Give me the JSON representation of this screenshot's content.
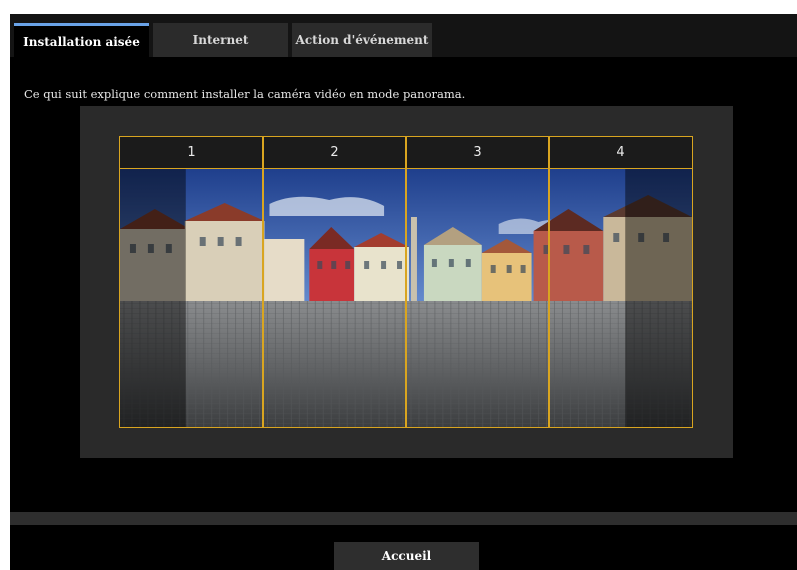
{
  "tabs": [
    {
      "label": "Installation aisée",
      "active": true
    },
    {
      "label": "Internet",
      "active": false
    },
    {
      "label": "Action d'événement",
      "active": false
    }
  ],
  "description": "Ce qui suit explique comment installer la caméra vidéo en mode panorama.",
  "segments": [
    "1",
    "2",
    "3",
    "4"
  ],
  "home_button": "Accueil",
  "colors": {
    "accent_tab": "#6aa3e8",
    "segment_border": "#d9a520",
    "background": "#000000",
    "panel": "#2a2a2a"
  }
}
